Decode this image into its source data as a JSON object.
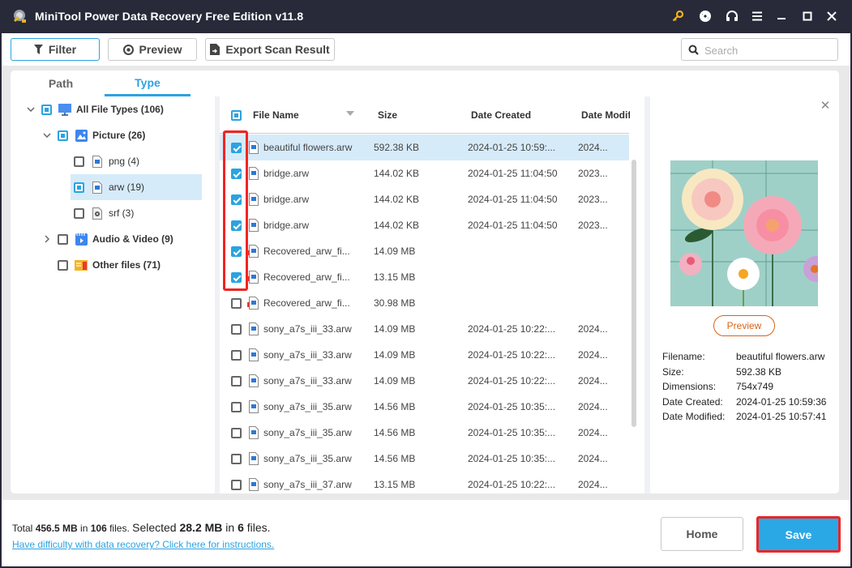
{
  "window": {
    "title": "MiniTool Power Data Recovery Free Edition v11.8",
    "icons": [
      "key-icon",
      "disc-icon",
      "headset-icon",
      "menu-icon",
      "minimize-icon",
      "maximize-icon",
      "close-icon"
    ]
  },
  "toolbar": {
    "filter_label": "Filter",
    "preview_label": "Preview",
    "export_label": "Export Scan Result",
    "search_placeholder": "Search",
    "search_value": ""
  },
  "tabs": [
    {
      "label": "Path",
      "active": false
    },
    {
      "label": "Type",
      "active": true
    }
  ],
  "tree": [
    {
      "label": "All File Types (106)",
      "state": "partial",
      "expanded": true,
      "icon": "monitor-icon",
      "bold": true
    },
    {
      "label": "Picture (26)",
      "state": "partial",
      "expanded": true,
      "icon": "picture-icon",
      "bold": true
    },
    {
      "label": "png (4)",
      "state": "unchecked",
      "icon": "image-file-icon",
      "bold": false
    },
    {
      "label": "arw (19)",
      "state": "partial",
      "icon": "image-file-icon",
      "bold": false,
      "selected": true
    },
    {
      "label": "srf (3)",
      "state": "unchecked",
      "icon": "camera-file-icon",
      "bold": false
    },
    {
      "label": "Audio & Video (9)",
      "state": "unchecked",
      "expanded": false,
      "icon": "video-icon",
      "bold": true
    },
    {
      "label": "Other files (71)",
      "state": "unchecked",
      "icon": "folder-icon",
      "bold": true
    }
  ],
  "list": {
    "columns": {
      "name": "File Name",
      "size": "Size",
      "created": "Date Created",
      "modified": "Date Modif"
    },
    "rows": [
      {
        "name": "beautiful flowers.arw",
        "size": "592.38 KB",
        "created": "2024-01-25 10:59:...",
        "modified": "2024...",
        "checked": true,
        "selected": true,
        "damaged": false
      },
      {
        "name": "bridge.arw",
        "size": "144.02 KB",
        "created": "2024-01-25 11:04:50",
        "modified": "2023...",
        "checked": true,
        "damaged": false
      },
      {
        "name": "bridge.arw",
        "size": "144.02 KB",
        "created": "2024-01-25 11:04:50",
        "modified": "2023...",
        "checked": true,
        "damaged": false
      },
      {
        "name": "bridge.arw",
        "size": "144.02 KB",
        "created": "2024-01-25 11:04:50",
        "modified": "2023...",
        "checked": true,
        "damaged": false
      },
      {
        "name": "Recovered_arw_fi...",
        "size": "14.09 MB",
        "created": "",
        "modified": "",
        "checked": true,
        "damaged": true
      },
      {
        "name": "Recovered_arw_fi...",
        "size": "13.15 MB",
        "created": "",
        "modified": "",
        "checked": true,
        "damaged": true
      },
      {
        "name": "Recovered_arw_fi...",
        "size": "30.98 MB",
        "created": "",
        "modified": "",
        "checked": false,
        "damaged": true
      },
      {
        "name": "sony_a7s_iii_33.arw",
        "size": "14.09 MB",
        "created": "2024-01-25 10:22:...",
        "modified": "2024...",
        "checked": false,
        "damaged": false
      },
      {
        "name": "sony_a7s_iii_33.arw",
        "size": "14.09 MB",
        "created": "2024-01-25 10:22:...",
        "modified": "2024...",
        "checked": false,
        "damaged": false
      },
      {
        "name": "sony_a7s_iii_33.arw",
        "size": "14.09 MB",
        "created": "2024-01-25 10:22:...",
        "modified": "2024...",
        "checked": false,
        "damaged": false
      },
      {
        "name": "sony_a7s_iii_35.arw",
        "size": "14.56 MB",
        "created": "2024-01-25 10:35:...",
        "modified": "2024...",
        "checked": false,
        "damaged": false
      },
      {
        "name": "sony_a7s_iii_35.arw",
        "size": "14.56 MB",
        "created": "2024-01-25 10:35:...",
        "modified": "2024...",
        "checked": false,
        "damaged": false
      },
      {
        "name": "sony_a7s_iii_35.arw",
        "size": "14.56 MB",
        "created": "2024-01-25 10:35:...",
        "modified": "2024...",
        "checked": false,
        "damaged": false
      },
      {
        "name": "sony_a7s_iii_37.arw",
        "size": "13.15 MB",
        "created": "2024-01-25 10:22:...",
        "modified": "2024...",
        "checked": false,
        "damaged": false
      }
    ]
  },
  "preview": {
    "button_label": "Preview",
    "info": [
      {
        "key": "Filename:",
        "value": "beautiful flowers.arw"
      },
      {
        "key": "Size:",
        "value": "592.38 KB"
      },
      {
        "key": "Dimensions:",
        "value": "754x749"
      },
      {
        "key": "Date Created:",
        "value": "2024-01-25 10:59:36"
      },
      {
        "key": "Date Modified:",
        "value": "2024-01-25 10:57:41"
      }
    ]
  },
  "status": {
    "total_prefix": "Total ",
    "total_size": "456.5 MB",
    "in1": " in ",
    "total_files": "106",
    "files1": " files.  ",
    "selected_prefix": "Selected ",
    "selected_size": "28.2 MB",
    "in2": " in ",
    "selected_files": "6",
    "files2": " files.",
    "help_link": "Have difficulty with data recovery? Click here for instructions."
  },
  "footer": {
    "home_label": "Home",
    "save_label": "Save"
  },
  "colors": {
    "accent": "#2ba3e0",
    "titlebar": "#282a3a",
    "highlight_red": "#f02424",
    "preview_orange": "#d4651d",
    "selected_row": "#d6ebf9"
  }
}
